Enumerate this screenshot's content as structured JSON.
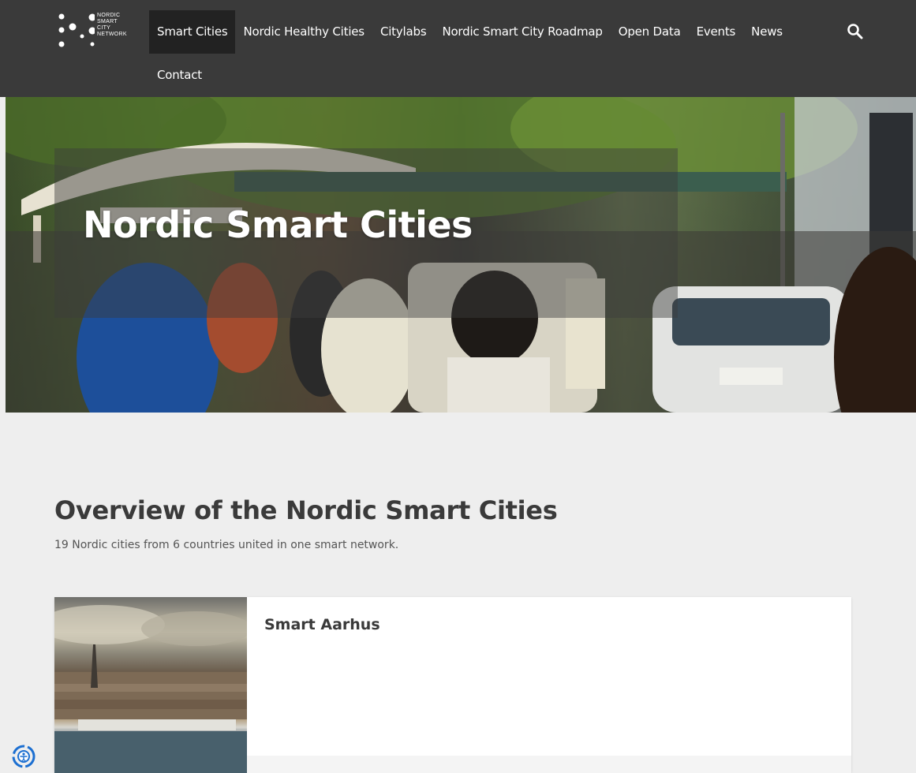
{
  "logo": {
    "lines": [
      "NORDIC",
      "SMART",
      "CITY",
      "NETWORK"
    ]
  },
  "nav": {
    "items": [
      {
        "label": "Smart Cities",
        "active": true
      },
      {
        "label": "Nordic Healthy Cities",
        "active": false
      },
      {
        "label": "Citylabs",
        "active": false
      },
      {
        "label": "Nordic Smart City Roadmap",
        "active": false
      },
      {
        "label": "Open Data",
        "active": false
      },
      {
        "label": "Events",
        "active": false
      },
      {
        "label": "News",
        "active": false
      }
    ],
    "second_row": [
      {
        "label": "Contact",
        "active": false
      }
    ],
    "search_icon": "search-icon"
  },
  "hero": {
    "title": "Nordic Smart Cities"
  },
  "overview": {
    "title": "Overview of the Nordic Smart Cities",
    "subtitle": "19 Nordic cities from 6 countries united in one smart network."
  },
  "cards": [
    {
      "name": "Smart Aarhus"
    }
  ],
  "colors": {
    "nav_bg": "#3a3a3a",
    "nav_active_bg": "#222222",
    "page_bg": "#eeeeee",
    "accessibility_blue": "#1c6fd1"
  },
  "accessibility": {
    "icon": "accessibility-icon"
  }
}
